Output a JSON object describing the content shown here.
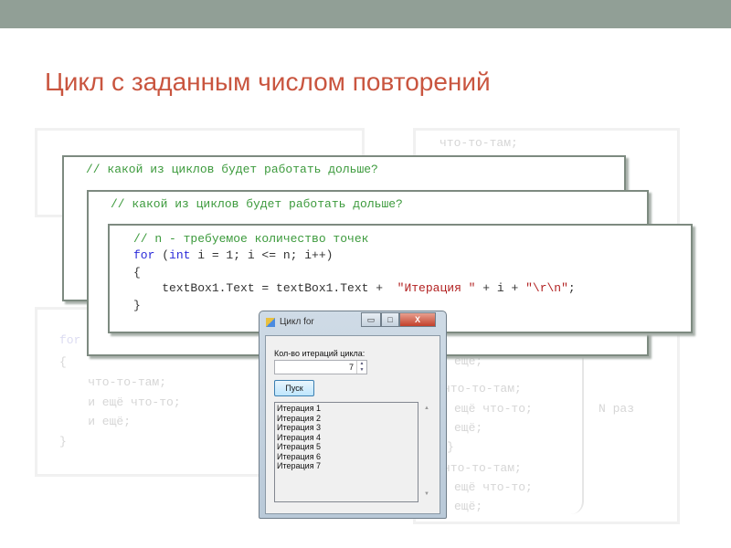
{
  "slide": {
    "title": "Цикл с заданным числом повторений",
    "accent": "#c9553f",
    "topbar_color": "#919f96"
  },
  "background_left": {
    "lines": [
      "for",
      "{",
      "    что-то-там;",
      "    и ещё что-то;",
      "    и ещё;",
      "}"
    ]
  },
  "background_right": {
    "lines": [
      "что-то-там;",
      "ещё;",
      "что-то-там;",
      "ещё что-то;",
      "ещё;",
      "}",
      "что-то-там;",
      "ещё что-то;",
      "ещё;"
    ],
    "brace_label": "N раз"
  },
  "card1": {
    "comment": "// какой из циклов будет работать дольше?"
  },
  "card2": {
    "comment": "// какой из циклов будет работать дольше?"
  },
  "card3": {
    "comment": "// n - требуемое количество точек",
    "for_kw": "for",
    "paren_open": " (",
    "int_kw": "int",
    "loop_rest": " i = 1; i <= n; i++)",
    "brace_open": "{",
    "stmt_start": "    textBox1.Text = textBox1.Text +  ",
    "str1": "\"Итерация \"",
    "stmt_mid": " + i + ",
    "str2": "\"\\r\\n\"",
    "stmt_end": ";",
    "brace_close": "}"
  },
  "dialog": {
    "title": "Цикл for",
    "minimize": "▭",
    "maximize": "□",
    "close": "X",
    "label": "Кол-во итераций цикла:",
    "value": "7",
    "button": "Пуск",
    "items": [
      "Итерация 1",
      "Итерация 2",
      "Итерация 3",
      "Итерация 4",
      "Итерация 5",
      "Итерация 6",
      "Итерация 7"
    ]
  }
}
